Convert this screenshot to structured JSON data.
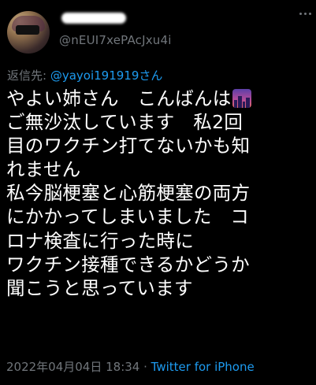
{
  "author": {
    "handle": "@nEUI7xePAcJxu4i"
  },
  "reply": {
    "prefix": "返信先: ",
    "mention": "@yayoi191919",
    "suffix": "さん"
  },
  "tweet": {
    "lines": [
      "やよい姉さん　こんばんは",
      "ご無沙汰しています　私2回",
      "目のワクチン打てないかも知",
      "れません",
      "私今脳梗塞と心筋梗塞の両方",
      "にかかってしまいました　コ",
      "ロナ検査に行った時に",
      "ワクチン接種できるかどうか",
      "聞こうと思っています"
    ],
    "emoji": "city-dusk-icon"
  },
  "meta": {
    "timestamp": "2022年04月04日 18:34",
    "separator": " · ",
    "source": "Twitter for iPhone"
  },
  "colors": {
    "background": "#000000",
    "text": "#ffffff",
    "secondary": "#71767b",
    "link": "#1d9bf0"
  }
}
